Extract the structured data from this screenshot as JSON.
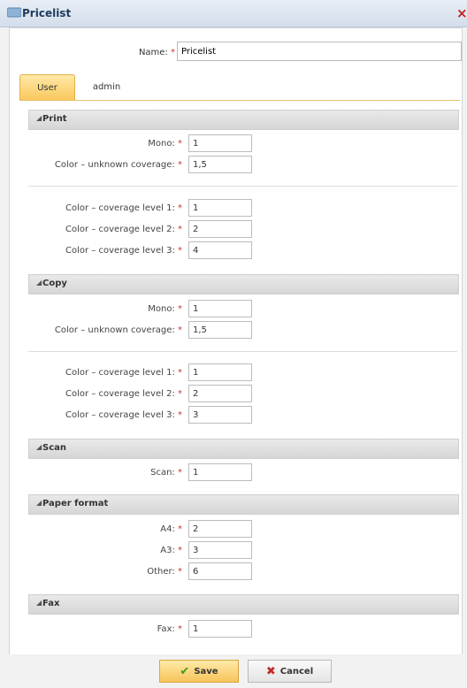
{
  "window": {
    "title": "Pricelist",
    "close_symbol": "×"
  },
  "name_field": {
    "label": "Name:",
    "required": "*",
    "value": "Pricelist"
  },
  "tabs": [
    {
      "label": "User",
      "active": true
    },
    {
      "label": "admin",
      "active": false
    }
  ],
  "sections": {
    "print": {
      "title": "Print",
      "mono": {
        "label": "Mono:",
        "value": "1"
      },
      "color_unknown": {
        "label": "Color – unknown coverage:",
        "value": "1,5"
      },
      "level1": {
        "label": "Color – coverage level 1:",
        "value": "1"
      },
      "level2": {
        "label": "Color – coverage level 2:",
        "value": "2"
      },
      "level3": {
        "label": "Color – coverage level 3:",
        "value": "4"
      }
    },
    "copy": {
      "title": "Copy",
      "mono": {
        "label": "Mono:",
        "value": "1"
      },
      "color_unknown": {
        "label": "Color – unknown coverage:",
        "value": "1,5"
      },
      "level1": {
        "label": "Color – coverage level 1:",
        "value": "1"
      },
      "level2": {
        "label": "Color – coverage level 2:",
        "value": "2"
      },
      "level3": {
        "label": "Color – coverage level 3:",
        "value": "3"
      }
    },
    "scan": {
      "title": "Scan",
      "scan": {
        "label": "Scan:",
        "value": "1"
      }
    },
    "paper": {
      "title": "Paper format",
      "a4": {
        "label": "A4:",
        "value": "2"
      },
      "a3": {
        "label": "A3:",
        "value": "3"
      },
      "other": {
        "label": "Other:",
        "value": "6"
      }
    },
    "fax": {
      "title": "Fax",
      "fax": {
        "label": "Fax:",
        "value": "1"
      }
    }
  },
  "required_marker": "*",
  "collapse_symbol": "◢",
  "buttons": {
    "save": "Save",
    "cancel": "Cancel",
    "save_icon": "✔",
    "cancel_icon": "✖"
  },
  "colors": {
    "accent": "#f9c75a",
    "title_text": "#1f3a5c",
    "close": "#c02020",
    "check": "#3d9a1e",
    "cross": "#c22a2a"
  }
}
